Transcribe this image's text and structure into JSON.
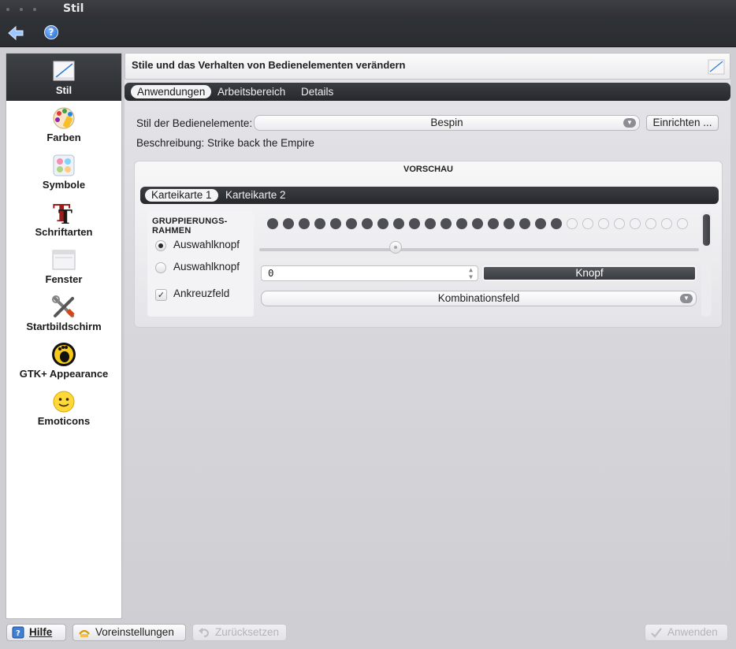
{
  "window": {
    "title": "Stil"
  },
  "toolbar": {
    "back_icon": "back-arrow-icon",
    "help_icon": "help-icon",
    "help_glyph": "?"
  },
  "sidebar": {
    "items": [
      {
        "label": "Stil",
        "icon": "style-icon",
        "active": true
      },
      {
        "label": "Farben",
        "icon": "colors-palette-icon",
        "active": false
      },
      {
        "label": "Symbole",
        "icon": "icons-icon",
        "active": false
      },
      {
        "label": "Schriftarten",
        "icon": "fonts-icon",
        "active": false
      },
      {
        "label": "Fenster",
        "icon": "window-icon",
        "active": false
      },
      {
        "label": "Startbildschirm",
        "icon": "tools-icon",
        "active": false
      },
      {
        "label": "GTK+ Appearance",
        "icon": "gtk-gnome-icon",
        "active": false
      },
      {
        "label": "Emoticons",
        "icon": "smiley-icon",
        "active": false
      }
    ]
  },
  "header": {
    "title": "Stile und das Verhalten von Bedienelementen verändern"
  },
  "tabs": [
    {
      "label": "Anwendungen",
      "active": true
    },
    {
      "label": "Arbeitsbereich",
      "active": false
    },
    {
      "label": "Details",
      "active": false
    }
  ],
  "style_row": {
    "label": "Stil der Bedienelemente:",
    "value": "Bespin",
    "configure_button": "Einrichten ..."
  },
  "description": "Beschreibung: Strike back the Empire",
  "preview": {
    "title": "VORSCHAU",
    "tabs": [
      {
        "label": "Karteikarte 1",
        "active": true
      },
      {
        "label": "Karteikarte 2",
        "active": false
      }
    ],
    "group": {
      "title": "GRUPPIERUNGS-RAHMEN",
      "radio1": "Auswahlknopf",
      "radio2": "Auswahlknopf",
      "checkbox": "Ankreuzfeld",
      "check_mark": "✓"
    },
    "progress": {
      "total_dots": 27,
      "filled_dots": 19
    },
    "slider_value_fraction": 0.31,
    "spin_value": "0",
    "button": "Knopf",
    "combo": "Kombinationsfeld"
  },
  "footer": {
    "help": "Hilfe",
    "defaults": "Voreinstellungen",
    "reset": "Zurücksetzen",
    "apply": "Anwenden"
  },
  "colors": {
    "dark_bar": "#2b2d31",
    "accent_blue": "#1f63c9",
    "progress_fill": "#4d4f55"
  }
}
